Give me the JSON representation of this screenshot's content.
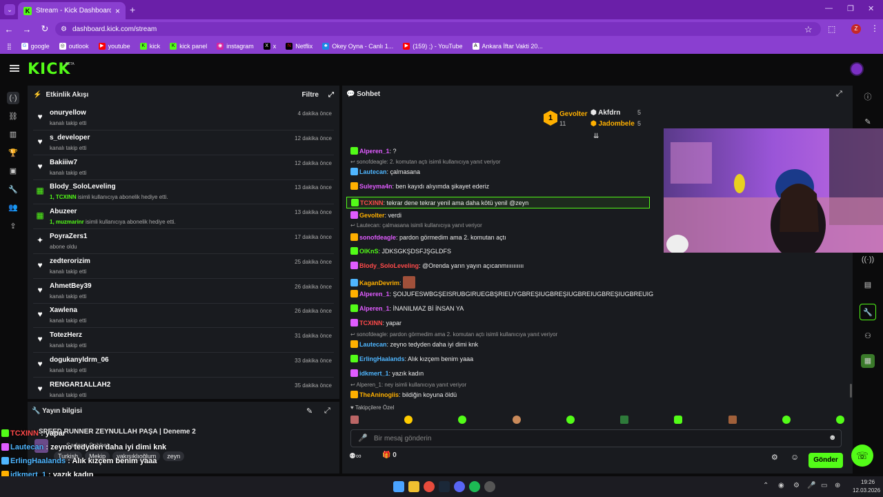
{
  "browser": {
    "tab_title": "Stream - Kick Dashboard",
    "url": "dashboard.kick.com/stream",
    "profile_initial": "Z",
    "bookmarks": [
      "google",
      "outlook",
      "youtube",
      "kick",
      "kick panel",
      "instagram",
      "x",
      "Netflix",
      "Okey Oyna - Canlı 1...",
      "(159) ;) - YouTube",
      "Ankara İftar Vakti 20..."
    ]
  },
  "app": {
    "logo": "KICK",
    "beta": "BETA"
  },
  "activity": {
    "title": "Etkinlik Akışı",
    "filter": "Filtre",
    "items": [
      {
        "icon": "heart",
        "name": "onuryellow",
        "sub": "kanalı takip etti",
        "time": "4 dakika önce"
      },
      {
        "icon": "heart",
        "name": "s_developer",
        "sub": "kanalı takip etti",
        "time": "12 dakika önce"
      },
      {
        "icon": "heart",
        "name": "Bakiiiw7",
        "sub": "kanalı takip etti",
        "time": "12 dakika önce"
      },
      {
        "icon": "gift",
        "name": "Blody_SoloLeveling",
        "sub_prefix": "1, TCXINN",
        "sub": " isimli kullanıcıya abonelik hediye etti.",
        "time": "13 dakika önce"
      },
      {
        "icon": "gift",
        "name": "Abuzeer",
        "sub_prefix": "1, muzmarinr",
        "sub": " isimli kullanıcıya abonelik hediye etti.",
        "time": "13 dakika önce"
      },
      {
        "icon": "star",
        "name": "PoyraZers1",
        "sub": "abone oldu",
        "time": "17 dakika önce"
      },
      {
        "icon": "heart",
        "name": "zedterorizim",
        "sub": "kanalı takip etti",
        "time": "25 dakika önce"
      },
      {
        "icon": "heart",
        "name": "AhmetBey39",
        "sub": "kanalı takip etti",
        "time": "26 dakika önce"
      },
      {
        "icon": "heart",
        "name": "Xawlena",
        "sub": "kanalı takip etti",
        "time": "26 dakika önce"
      },
      {
        "icon": "heart",
        "name": "TotezHerz",
        "sub": "kanalı takip etti",
        "time": "31 dakika önce"
      },
      {
        "icon": "heart",
        "name": "dogukanyldrm_06",
        "sub": "kanalı takip etti",
        "time": "33 dakika önce"
      },
      {
        "icon": "heart",
        "name": "RENGAR1ALLAH2",
        "sub": "kanalı takip etti",
        "time": "35 dakika önce"
      }
    ]
  },
  "stream_info": {
    "title": "Yayın bilgisi",
    "stream_title": "SPEED RUNNER ZEYNULLAH PAŞA | Deneme 2",
    "category": "Sadece Sohbet",
    "tags": [
      "Turkish",
      "Mekip",
      "yakışıklıoğlum",
      "zeyn"
    ]
  },
  "chat": {
    "title": "Sohbet",
    "leaderboard": [
      {
        "name": "Gevolter",
        "rank": "1",
        "count": "11"
      },
      {
        "name": "Akfdrn",
        "count": "5"
      },
      {
        "name": "Jadombele",
        "count": "5"
      }
    ],
    "messages": [
      {
        "user": "Alperen_1",
        "color": "#e05cff",
        "text": "?"
      },
      {
        "reply": "sonofdeagle: 2. komutan açtı isimli kullanıcıya yanıt veriyor"
      },
      {
        "user": "Lautecan",
        "color": "#4fb6ff",
        "text": "çalmasana"
      },
      {
        "user": "Suleyma4n",
        "color": "#e05cff",
        "text": "ben kayıdı alıyımda şikayet ederiz"
      },
      {
        "user": "TCXINN",
        "color": "#ff4a4a",
        "text": "tekrar dene tekrar yenil ama daha kötü yenil @zeyn",
        "highlight": true
      },
      {
        "user": "Gevolter",
        "color": "#ffb000",
        "text": "verdi"
      },
      {
        "reply": "Lautecan: çalmasana isimli kullanıcıya yanıt veriyor"
      },
      {
        "user": "sonofdeagle",
        "color": "#e05cff",
        "text": "pardon görmedim ama 2. komutan açtı"
      },
      {
        "user": "OlKnS",
        "color": "#53fc18",
        "text": "JDKSGKŞDSFJŞGLDFS"
      },
      {
        "user": "Blody_SoloLeveling",
        "color": "#ff4a4a",
        "text": "@Orenda yarın yayın açıcanmıııııııııı"
      },
      {
        "user": "KaganDevrim",
        "color": "#ffb000",
        "text": ""
      },
      {
        "user": "Alperen_1",
        "color": "#e05cff",
        "text": "ŞOIJUFESWBGŞEISRUBGIRUEGBŞRIEUYGBREŞIUGBREŞIUGBREIUGBREŞIUGBREUIG"
      },
      {
        "user": "Alperen_1",
        "color": "#e05cff",
        "text": "İNANILMAZ Bİ İNSAN YA"
      },
      {
        "user": "TCXINN",
        "color": "#ff4a4a",
        "text": "yapar"
      },
      {
        "reply": "sonofdeagle: pardon görmedim ama 2. komutan açtı isimli kullanıcıya yanıt veriyor"
      },
      {
        "user": "Lautecan",
        "color": "#4fb6ff",
        "text": "zeyno tedyden daha iyi dimi knk"
      },
      {
        "user": "ErlingHaalands",
        "color": "#4fb6ff",
        "text": "Alık kızçem benim yaaa"
      },
      {
        "user": "idkmert_1",
        "color": "#4fb6ff",
        "text": "yazık kadın"
      },
      {
        "reply": "Alperen_1: ney isimli kullanıcıya yanıt veriyor"
      },
      {
        "user": "TheAninogiis",
        "color": "#ffb000",
        "text": "bildiğin koyuna öldü"
      }
    ],
    "emote_section": "Takipçilere Özel",
    "input_placeholder": "Bir mesaj gönderin",
    "points": "0",
    "send": "Gönder"
  },
  "overlay": [
    {
      "user": "TCXINN",
      "color": "#ff4a4a",
      "text": "yapar"
    },
    {
      "user": "Lautecan",
      "color": "#4fb6ff",
      "text": "zeyno tedyden daha iyi dimi knk"
    },
    {
      "user": "ErlingHaalands",
      "color": "#4fb6ff",
      "text": "Alık kızçem benim yaaa"
    },
    {
      "user": "idkmert_1",
      "color": "#4fb6ff",
      "text": "yazık kadın"
    },
    {
      "user": "TheAninogiis",
      "color": "#ffb000",
      "text": "bildiğin koyuna öldü"
    }
  ],
  "taskbar": {
    "time": "19:26",
    "date": "12.03.2026"
  }
}
